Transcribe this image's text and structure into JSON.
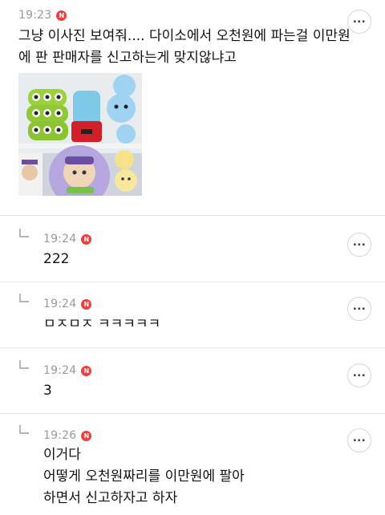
{
  "comments": [
    {
      "time": "19:23",
      "badge": "N",
      "lines": [
        "그냥 이사진 보여줘.... 다이소에서 오천원에 파는걸 이만원",
        "에 판 판매자를 신고하는게 맞지않냐고"
      ],
      "has_image": true
    },
    {
      "time": "19:24",
      "badge": "N",
      "lines": [
        "222"
      ],
      "is_reply": true
    },
    {
      "time": "19:24",
      "badge": "N",
      "lines": [
        "ㅁㅈㅁㅈ ㅋㅋㅋㅋㅋ"
      ],
      "is_reply": true
    },
    {
      "time": "19:24",
      "badge": "N",
      "lines": [
        "3"
      ],
      "is_reply": true
    },
    {
      "time": "19:26",
      "badge": "N",
      "lines": [
        "이거다",
        "어떻게 오천원짜리를 이만원에 팔아",
        "하면서 신고하자고 하자"
      ],
      "is_reply": true
    }
  ],
  "icons": {
    "more": "more-horizontal-icon",
    "reply": "reply-arrow-icon",
    "new": "new-badge-icon"
  },
  "colors": {
    "badge": "#ef3e3e",
    "time": "#9a9a9a",
    "divider": "#e6e6e6"
  }
}
